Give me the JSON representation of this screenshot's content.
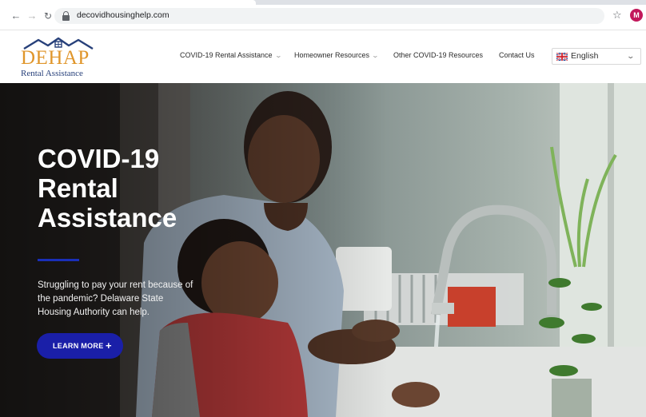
{
  "browser": {
    "url": "decovidhousinghelp.com",
    "back_icon": "arrow-left-icon",
    "forward_icon": "arrow-right-icon",
    "reload_icon": "reload-icon",
    "bookmark_icon": "star-icon",
    "profile_initial": "M",
    "profile_color": "#c2185b"
  },
  "logo": {
    "word": "DEHAP",
    "subtitle": "Rental Assistance",
    "word_color": "#e0962b",
    "subtitle_color": "#27407a"
  },
  "nav": {
    "items": [
      {
        "label": "COVID-19 Rental Assistance",
        "has_dropdown": true
      },
      {
        "label": "Homeowner Resources",
        "has_dropdown": true
      },
      {
        "label": "Other COVID-19 Resources",
        "has_dropdown": false
      },
      {
        "label": "Contact Us",
        "has_dropdown": false
      }
    ],
    "chevron_glyph": "⌄"
  },
  "language": {
    "selected": "English",
    "flag_icon": "uk-flag-icon"
  },
  "hero": {
    "title_lines": [
      "COVID-19",
      "Rental",
      "Assistance"
    ],
    "body_lines": [
      "Struggling to pay your rent because of",
      "the pandemic? Delaware State",
      "Housing Authority can help."
    ],
    "button_label": "LEARN MORE",
    "button_icon": "+",
    "accent_color": "#1a1fa8"
  }
}
